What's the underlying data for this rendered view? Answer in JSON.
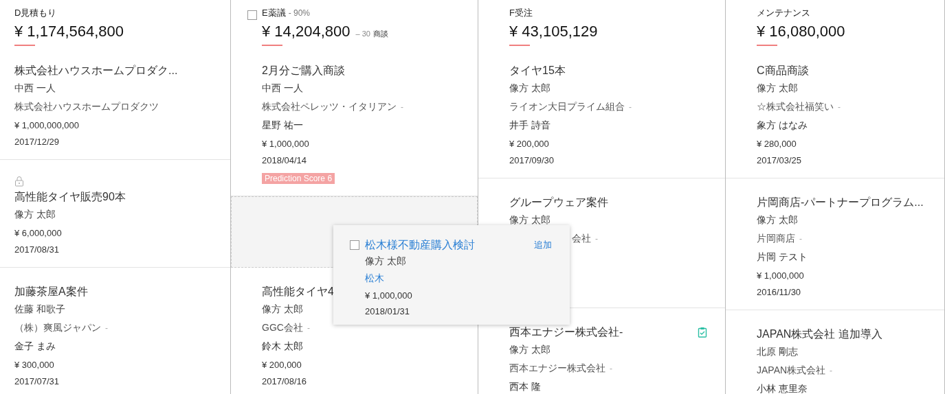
{
  "columns": [
    {
      "stage": "D見積もり",
      "total": "¥ 1,174,564,800",
      "items": [
        {
          "kind": "card",
          "title": "株式会社ハウスホームプロダク...",
          "locked": false,
          "task": false,
          "lines": [
            {
              "kind": "person",
              "text": "中西 一人"
            },
            {
              "kind": "company",
              "text": "株式会社ハウスホームプロダクツ"
            }
          ],
          "amount": "¥ 1,000,000,000",
          "date": "2017/12/29"
        },
        {
          "kind": "card",
          "title": "高性能タイヤ販売90本",
          "locked": true,
          "task": false,
          "lines": [
            {
              "kind": "person",
              "text": "像方 太郎"
            }
          ],
          "amount": "¥ 6,000,000",
          "date": "2017/08/31"
        },
        {
          "kind": "card",
          "title": "加藤茶屋A案件",
          "locked": false,
          "task": false,
          "lines": [
            {
              "kind": "person",
              "text": "佐藤 和歌子"
            },
            {
              "kind": "company",
              "text": "（株）爽風ジャパン",
              "suffix": "-"
            },
            {
              "kind": "contact",
              "text": "金子 まみ"
            }
          ],
          "amount": "¥ 300,000",
          "date": "2017/07/31"
        }
      ]
    },
    {
      "stage": "E薬議",
      "checked": false,
      "probability": "- 90%",
      "total": "¥ 14,204,800",
      "deal_count": "– 30",
      "deal_label": "商談",
      "items": [
        {
          "kind": "card",
          "title": "2月分ご購入商談",
          "locked": false,
          "task": false,
          "lines": [
            {
              "kind": "person",
              "text": "中西 一人"
            },
            {
              "kind": "company",
              "text": "株式会社ペレッツ・イタリアン",
              "suffix": "-"
            },
            {
              "kind": "contact",
              "text": "星野 祐一"
            }
          ],
          "amount": "¥ 1,000,000",
          "date": "2018/04/14",
          "badge": "Prediction Score 6"
        },
        {
          "kind": "drop_zone"
        },
        {
          "kind": "card",
          "title": "高性能タイヤ4",
          "locked": false,
          "task": false,
          "lines": [
            {
              "kind": "person",
              "text": "像方 太郎"
            },
            {
              "kind": "company",
              "text": "GGC会社",
              "suffix": "-"
            },
            {
              "kind": "contact",
              "text": "鈴木 太郎"
            }
          ],
          "amount": "¥ 200,000",
          "date": "2017/08/16"
        }
      ]
    },
    {
      "stage": "F受注",
      "total": "¥ 43,105,129",
      "items": [
        {
          "kind": "card",
          "title": "タイヤ15本",
          "locked": false,
          "task": false,
          "lines": [
            {
              "kind": "person",
              "text": "像方 太郎"
            },
            {
              "kind": "company",
              "text": "ライオン大日プライム組合",
              "suffix": "-"
            },
            {
              "kind": "contact",
              "text": "井手 詩音"
            }
          ],
          "amount": "¥ 200,000",
          "date": "2017/09/30"
        },
        {
          "kind": "card",
          "title": "グループウェア案件",
          "locked": false,
          "task": false,
          "covered": true,
          "lines": [
            {
              "kind": "person",
              "text": "像方 太郎"
            },
            {
              "kind": "company",
              "text": "会社",
              "suffix": "-",
              "partly_hidden": true
            }
          ]
        },
        {
          "kind": "card",
          "title": "西本エナジー株式会社-",
          "locked": false,
          "task": true,
          "lines": [
            {
              "kind": "person",
              "text": "像方 太郎"
            },
            {
              "kind": "company",
              "text": "西本エナジー株式会社",
              "suffix": "-"
            },
            {
              "kind": "contact",
              "text": "西本 隆"
            }
          ]
        }
      ]
    },
    {
      "stage": "メンテナンス",
      "total": "¥ 16,080,000",
      "items": [
        {
          "kind": "card",
          "title": "C商品商談",
          "locked": false,
          "task": false,
          "lines": [
            {
              "kind": "person",
              "text": "像方 太郎"
            },
            {
              "kind": "company",
              "text": "☆株式会社福笑い",
              "suffix": "-"
            },
            {
              "kind": "contact",
              "text": "象方 はなみ"
            }
          ],
          "amount": "¥ 280,000",
          "date": "2017/03/25"
        },
        {
          "kind": "card",
          "title": "片岡商店-パートナープログラム...",
          "locked": false,
          "task": false,
          "lines": [
            {
              "kind": "person",
              "text": "像方 太郎"
            },
            {
              "kind": "company",
              "text": "片岡商店",
              "suffix": "-"
            },
            {
              "kind": "contact",
              "text": "片岡 テスト"
            }
          ],
          "amount": "¥ 1,000,000",
          "date": "2016/11/30"
        },
        {
          "kind": "card",
          "title": "JAPAN株式会社 追加導入",
          "locked": false,
          "task": false,
          "lines": [
            {
              "kind": "person",
              "text": "北原 剛志"
            },
            {
              "kind": "company",
              "text": "JAPAN株式会社",
              "suffix": "-"
            },
            {
              "kind": "contact",
              "text": "小林 恵里奈"
            }
          ]
        }
      ]
    }
  ],
  "popup": {
    "checked": false,
    "title": "松木様不動産購入検討",
    "add_button": "追加",
    "person": "像方 太郎",
    "contact": "松木",
    "amount": "¥ 1,000,000",
    "date": "2018/01/31"
  }
}
